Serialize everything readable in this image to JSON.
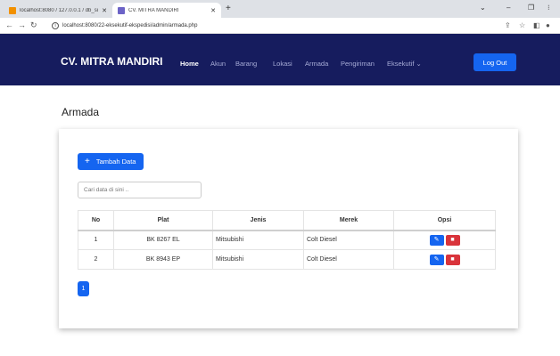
{
  "browser": {
    "tabs": [
      {
        "title": "localhost:8080 / 127.0.0.1 / db_si",
        "favicon_color": "#f29100"
      },
      {
        "title": "CV. MITRA MANDIRI",
        "favicon_color": "#6c63c7"
      }
    ],
    "new_tab_glyph": "+",
    "url": "localhost:8080/22-eksekutif-ekspedisi/admin/armada.php"
  },
  "navbar": {
    "brand": "CV. MITRA MANDIRI",
    "links": [
      "Home",
      "Akun",
      "Barang",
      "Lokasi",
      "Armada",
      "Pengiriman",
      "Eksekutif"
    ],
    "logout": "Log Out",
    "bg_color": "#161c5e"
  },
  "page": {
    "title": "Armada",
    "add_button": "Tambah Data",
    "search_placeholder": "Cari data di sini ..",
    "table": {
      "headers": [
        "No",
        "Plat",
        "Jenis",
        "Merek",
        "Opsi"
      ],
      "rows": [
        {
          "no": "1",
          "plat": "BK 8267 EL",
          "jenis": "Mitsubishi",
          "merek": "Colt Diesel"
        },
        {
          "no": "2",
          "plat": "BK 8943 EP",
          "jenis": "Mitsubishi",
          "merek": "Colt Diesel"
        }
      ]
    },
    "pagination": [
      "1"
    ]
  },
  "colors": {
    "primary": "#1565f0",
    "danger": "#d9343b"
  },
  "icons": [
    "pencil-icon",
    "trash-icon",
    "plus-icon"
  ]
}
